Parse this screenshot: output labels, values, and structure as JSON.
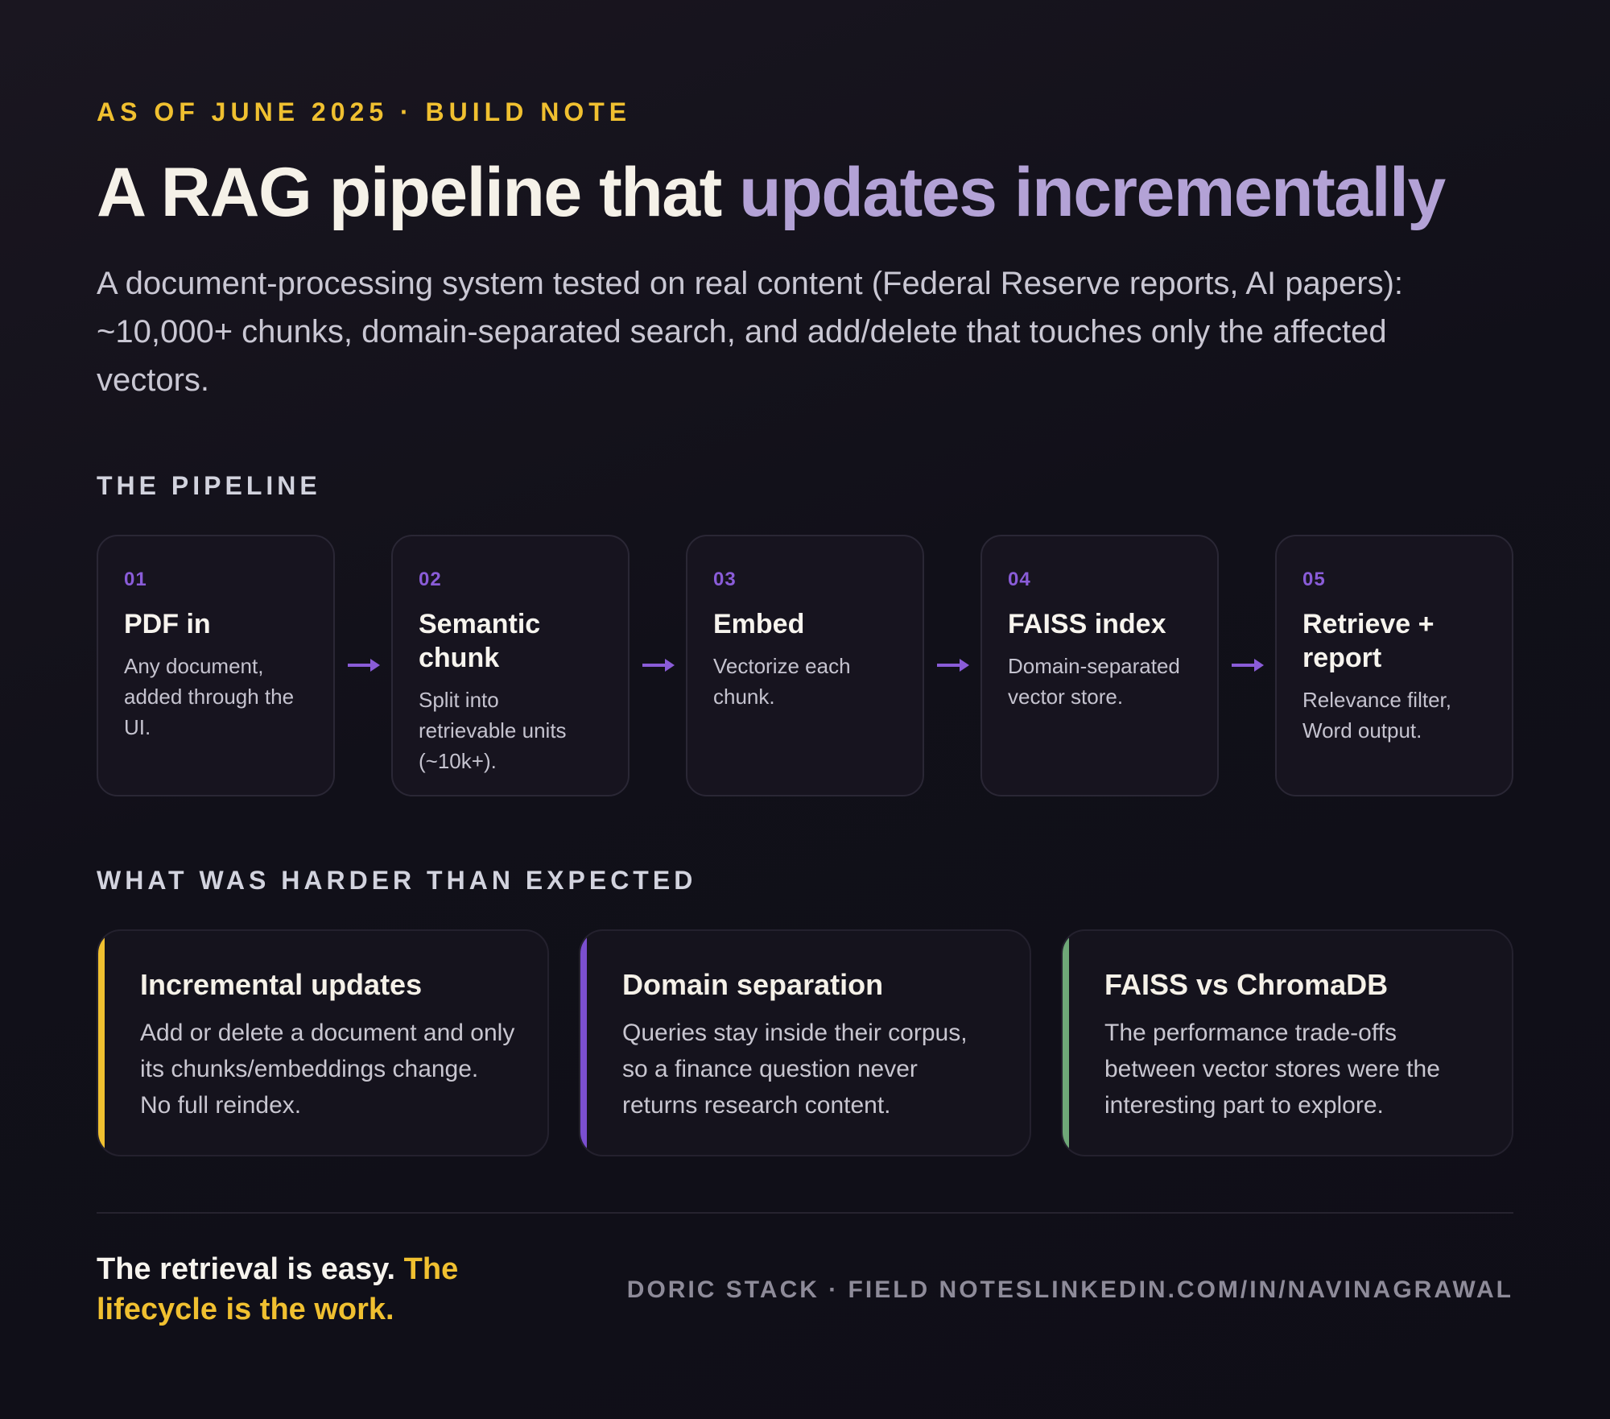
{
  "header": {
    "eyebrow": "AS OF JUNE 2025 · BUILD NOTE",
    "title_main": "A RAG pipeline that ",
    "title_accent": "updates incrementally",
    "subtitle": "A document-processing system tested on real content (Federal Reserve reports, AI papers): ~10,000+ chunks, domain-separated search, and add/delete that touches only the affected vectors."
  },
  "pipeline": {
    "label": "THE PIPELINE",
    "steps": [
      {
        "num": "01",
        "title": "PDF in",
        "desc": "Any document, added through the UI."
      },
      {
        "num": "02",
        "title": "Semantic chunk",
        "desc": "Split into retrievable units (~10k+)."
      },
      {
        "num": "03",
        "title": "Embed",
        "desc": "Vectorize each chunk."
      },
      {
        "num": "04",
        "title": "FAISS index",
        "desc": "Domain-separated vector store."
      },
      {
        "num": "05",
        "title": "Retrieve + report",
        "desc": "Relevance filter, Word output."
      }
    ]
  },
  "harder": {
    "label": "WHAT WAS HARDER THAN EXPECTED",
    "cards": [
      {
        "title": "Incremental updates",
        "desc": "Add or delete a document and only its chunks/embeddings change. No full reindex.",
        "color": "#f0c030"
      },
      {
        "title": "Domain separation",
        "desc": "Queries stay inside their corpus, so a finance question never returns research content.",
        "color": "#7b4fd0"
      },
      {
        "title": "FAISS vs ChromaDB",
        "desc": "The performance trade-offs between vector stores were the interesting part to explore.",
        "color": "#6fa878"
      }
    ]
  },
  "footer": {
    "tagline_main": "The retrieval is easy. ",
    "tagline_highlight": "The lifecycle is the work.",
    "signature": "DORIC STACK · FIELD NOTESLINKEDIN.COM/IN/NAVINAGRAWAL"
  },
  "colors": {
    "accent_gold": "#f0c030",
    "accent_lavender": "#b3a2d6",
    "accent_purple": "#8a5cd8",
    "accent_green": "#6fa878"
  }
}
